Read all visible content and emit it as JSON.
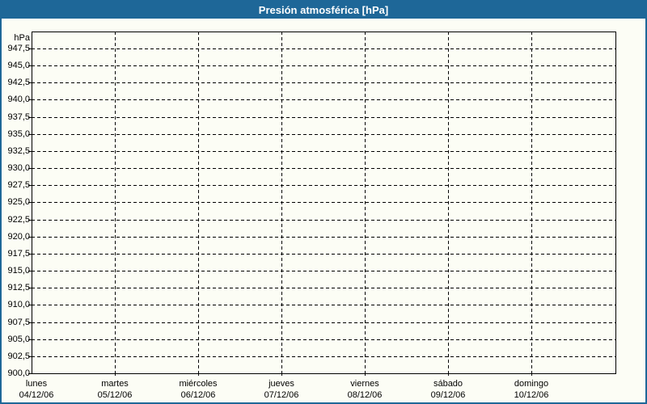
{
  "window": {
    "title": "Presión atmosférica [hPa]"
  },
  "colors": {
    "titlebar_bg": "#1E6798",
    "titlebar_text": "#FFFFFF",
    "frame_border": "#1E6798",
    "background": "#FCFDF5",
    "grid_line": "#000000",
    "label_text": "#000000"
  },
  "chart_data": {
    "type": "line",
    "title": "Presión atmosférica [hPa]",
    "unit_label": "hPa",
    "ylabel": "hPa",
    "xlabel": "",
    "ylim": [
      900,
      950
    ],
    "ytick_step": 2.5,
    "grid": true,
    "legend": null,
    "yticks": [
      {
        "value": 947.5,
        "label": "947,5"
      },
      {
        "value": 945.0,
        "label": "945,0"
      },
      {
        "value": 942.5,
        "label": "942,5"
      },
      {
        "value": 940.0,
        "label": "940,0"
      },
      {
        "value": 937.5,
        "label": "937,5"
      },
      {
        "value": 935.0,
        "label": "935,0"
      },
      {
        "value": 932.5,
        "label": "932,5"
      },
      {
        "value": 930.0,
        "label": "930,0"
      },
      {
        "value": 927.5,
        "label": "927,5"
      },
      {
        "value": 925.0,
        "label": "925,0"
      },
      {
        "value": 922.5,
        "label": "922,5"
      },
      {
        "value": 920.0,
        "label": "920,0"
      },
      {
        "value": 917.5,
        "label": "917,5"
      },
      {
        "value": 915.0,
        "label": "915,0"
      },
      {
        "value": 912.5,
        "label": "912,5"
      },
      {
        "value": 910.0,
        "label": "910,0"
      },
      {
        "value": 907.5,
        "label": "907,5"
      },
      {
        "value": 905.0,
        "label": "905,0"
      },
      {
        "value": 902.5,
        "label": "902,5"
      },
      {
        "value": 900.0,
        "label": "900,0"
      }
    ],
    "categories": [
      {
        "day": "lunes",
        "date": "04/12/06"
      },
      {
        "day": "martes",
        "date": "05/12/06"
      },
      {
        "day": "miércoles",
        "date": "06/12/06"
      },
      {
        "day": "jueves",
        "date": "07/12/06"
      },
      {
        "day": "viernes",
        "date": "08/12/06"
      },
      {
        "day": "sábado",
        "date": "09/12/06"
      },
      {
        "day": "domingo",
        "date": "10/12/06"
      }
    ],
    "series": []
  }
}
